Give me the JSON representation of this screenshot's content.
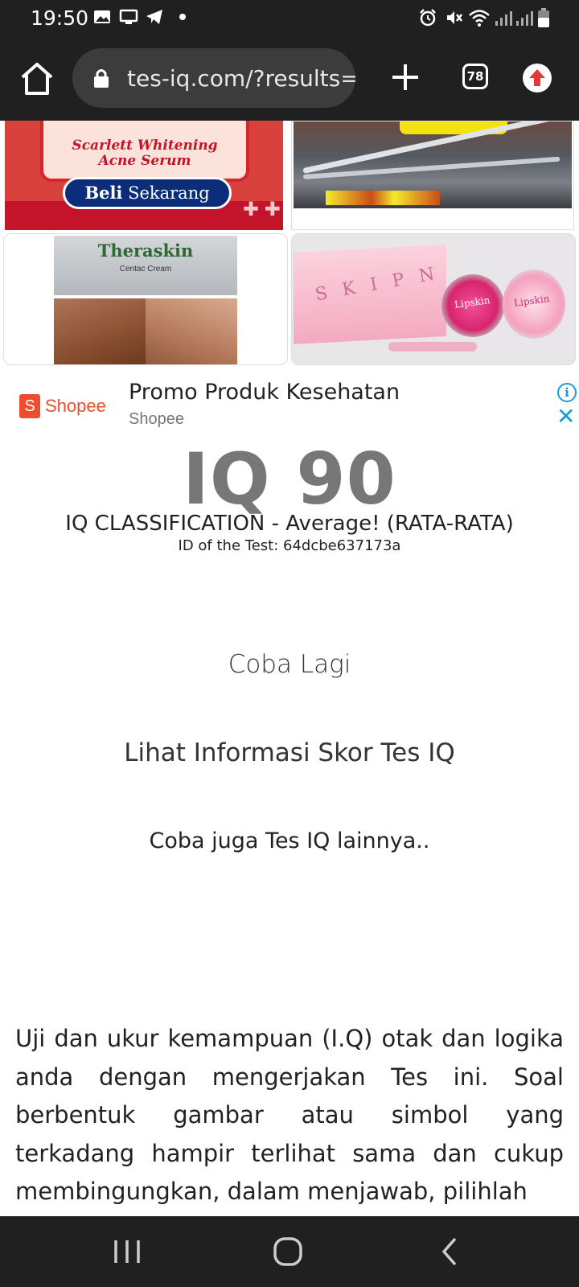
{
  "status_bar": {
    "time": "19:50",
    "left_icons": [
      "gallery-icon",
      "cast-icon",
      "telegram-icon",
      "dot-icon"
    ],
    "right_icons": [
      "alarm-icon",
      "mute-icon",
      "wifi-icon",
      "signal-icon",
      "signal-icon",
      "battery-icon"
    ]
  },
  "browser": {
    "url": "tes-iq.com/?results=",
    "tab_count": "78"
  },
  "product_tiles": {
    "tile1_line1": "Scarlett Whitening",
    "tile1_line2": "Acne Serum",
    "tile1_button_bold": "Beli",
    "tile1_button_rest": " Sekarang",
    "tile3_brand": "Theraskin",
    "tile3_product": "Centac Cream",
    "tile4_brand": "Lipskin"
  },
  "ad": {
    "logo_letter": "S",
    "logo_text": "Shopee",
    "title": "Promo Produk Kesehatan",
    "source": "Shopee",
    "info_label": "i",
    "close_label": "✕"
  },
  "result": {
    "score": "IQ 90",
    "classification": "IQ CLASSIFICATION - Average! (RATA-RATA)",
    "test_id": "ID of the Test: 64dcbe637173a"
  },
  "links": {
    "retry": "Coba Lagi",
    "info": "Lihat Informasi Skor Tes IQ",
    "other_tests": "Coba juga Tes IQ lainnya.."
  },
  "description": "Uji dan ukur kemampuan (I.Q) otak dan logika anda dengan mengerjakan Tes ini. Soal berbentuk gambar atau simbol yang terkadang hampir terlihat sama dan cukup membingungkan, dalam menjawab, pilihlah",
  "colors": {
    "chrome_dark": "#202020",
    "shopee_orange": "#ee4d2d",
    "ad_blue": "#1a9ad6",
    "score_gray": "#777777"
  }
}
